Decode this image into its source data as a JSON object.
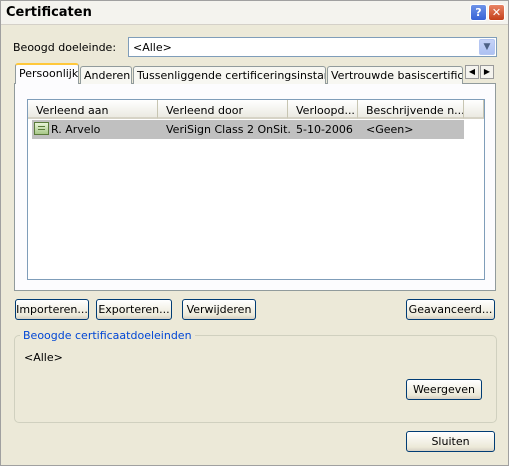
{
  "window": {
    "title": "Certificaten",
    "help_glyph": "?",
    "close_glyph": "✕"
  },
  "purpose": {
    "label": "Beoogd doeleinde:",
    "value": "<Alle>",
    "arrow": "▼"
  },
  "tabs": [
    {
      "label": "Persoonlijk"
    },
    {
      "label": "Anderen"
    },
    {
      "label": "Tussenliggende certificeringsinstanties"
    },
    {
      "label": "Vertrouwde basiscertificeri"
    }
  ],
  "tab_scroll": {
    "left": "◀",
    "right": "▶"
  },
  "list": {
    "columns": [
      "Verleend aan",
      "Verleend door",
      "Verloopd...",
      "Beschrijvende n..."
    ],
    "rows": [
      {
        "issued_to": "R. Arvelo",
        "issued_by": "VeriSign Class 2 OnSit...",
        "expires": "5-10-2006",
        "friendly_name": "<Geen>",
        "icon": "certificate-icon"
      }
    ]
  },
  "buttons": {
    "import": "Importeren...",
    "export": "Exporteren...",
    "remove": "Verwijderen",
    "advanced": "Geavanceerd...",
    "view": "Weergeven",
    "close": "Sluiten"
  },
  "purposes_group": {
    "title": "Beoogde certificaatdoeleinden",
    "value": "<Alle>"
  },
  "colors": {
    "dialog_bg": "#ece9d8",
    "selected_row": "#c0c0c0",
    "group_title": "#0046d5",
    "active_tab_accent": "#ffc83c"
  }
}
